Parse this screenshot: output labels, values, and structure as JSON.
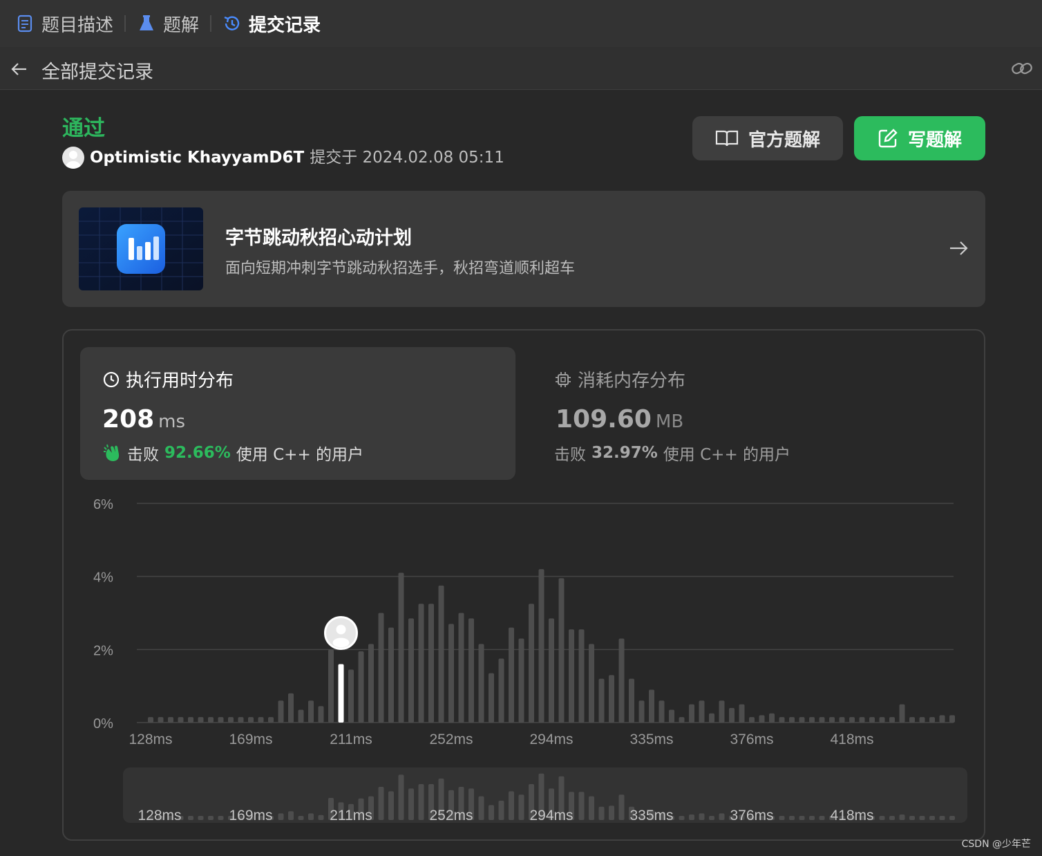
{
  "tabs": [
    {
      "label": "题目描述",
      "icon": "document-icon"
    },
    {
      "label": "题解",
      "icon": "flask-icon"
    },
    {
      "label": "提交记录",
      "icon": "history-icon"
    }
  ],
  "subheader": {
    "title": "全部提交记录"
  },
  "submission": {
    "status": "通过",
    "user": "Optimistic KhayyamD6T",
    "submitted_text": "提交于 2024.02.08 05:11"
  },
  "buttons": {
    "official_solution": "官方题解",
    "write_solution": "写题解"
  },
  "promo": {
    "title": "字节跳动秋招心动计划",
    "description": "面向短期冲刺字节跳动秋招选手，秋招弯道顺利超车"
  },
  "runtime": {
    "title": "执行用时分布",
    "value": "208",
    "unit": "ms",
    "beat_prefix": "击败",
    "beat_pct": "92.66%",
    "beat_suffix": "使用 C++ 的用户"
  },
  "memory": {
    "title": "消耗内存分布",
    "value": "109.60",
    "unit": "MB",
    "beat_prefix": "击败",
    "beat_pct": "32.97%",
    "beat_suffix": "使用 C++ 的用户"
  },
  "colors": {
    "accent_green": "#2cbb5d",
    "bar": "#4d4d4d",
    "bar_highlight": "#ffffff"
  },
  "chart_data": {
    "type": "bar",
    "title": "",
    "xlabel": "",
    "ylabel": "",
    "ylim": [
      0,
      6
    ],
    "yticks": [
      "6%",
      "4%",
      "2%",
      "0%"
    ],
    "ytick_values": [
      6,
      4,
      2,
      0
    ],
    "x_tick_labels": [
      "128ms",
      "169ms",
      "211ms",
      "252ms",
      "294ms",
      "335ms",
      "376ms",
      "418ms"
    ],
    "highlight_index": 19,
    "values": [
      0.15,
      0.15,
      0.15,
      0.15,
      0.15,
      0.15,
      0.15,
      0.15,
      0.15,
      0.15,
      0.15,
      0.15,
      0.15,
      0.6,
      0.8,
      0.35,
      0.6,
      0.45,
      2.0,
      1.6,
      1.45,
      1.95,
      2.15,
      3.0,
      2.6,
      4.1,
      2.85,
      3.25,
      3.25,
      3.75,
      2.7,
      3.0,
      2.85,
      2.15,
      1.35,
      1.75,
      2.6,
      2.3,
      3.25,
      4.2,
      2.85,
      3.95,
      2.55,
      2.55,
      2.15,
      1.2,
      1.3,
      2.3,
      1.2,
      0.6,
      0.9,
      0.6,
      0.35,
      0.15,
      0.5,
      0.6,
      0.25,
      0.6,
      0.4,
      0.5,
      0.15,
      0.2,
      0.25,
      0.15,
      0.15,
      0.15,
      0.15,
      0.15,
      0.15,
      0.15,
      0.15,
      0.15,
      0.15,
      0.15,
      0.15,
      0.5,
      0.15,
      0.15,
      0.15,
      0.2,
      0.2
    ]
  },
  "watermark": "CSDN @少年芒"
}
